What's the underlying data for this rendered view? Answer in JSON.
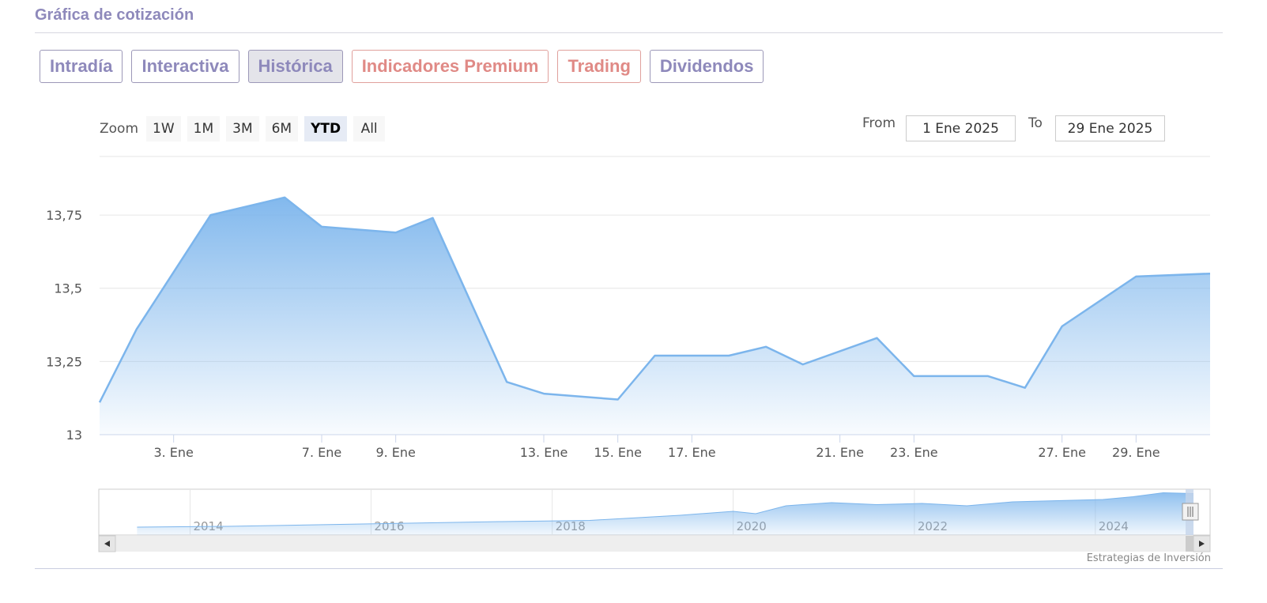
{
  "section_title": "Gráfica de cotización",
  "tabs": [
    {
      "label": "Intradía",
      "active": false,
      "premium": false
    },
    {
      "label": "Interactiva",
      "active": false,
      "premium": false
    },
    {
      "label": "Histórica",
      "active": true,
      "premium": false
    },
    {
      "label": "Indicadores Premium",
      "active": false,
      "premium": true
    },
    {
      "label": "Trading",
      "active": false,
      "premium": true
    },
    {
      "label": "Dividendos",
      "active": false,
      "premium": false
    }
  ],
  "zoom": {
    "label": "Zoom",
    "buttons": [
      {
        "label": "1W",
        "active": false
      },
      {
        "label": "1M",
        "active": false
      },
      {
        "label": "3M",
        "active": false
      },
      {
        "label": "6M",
        "active": false
      },
      {
        "label": "YTD",
        "active": true
      },
      {
        "label": "All",
        "active": false
      }
    ]
  },
  "range": {
    "from_label": "From",
    "from_value": "1 Ene 2025",
    "to_label": "To",
    "to_value": "29 Ene 2025"
  },
  "credits": "Estrategias de Inversión",
  "colors": {
    "line": "#7cb5ec",
    "tab_text": "#8e89bb",
    "premium_text": "#e08a86"
  },
  "chart_data": {
    "type": "area",
    "title": "",
    "xlabel": "",
    "ylabel": "",
    "x_type": "datetime",
    "xlim": [
      "2025-01-01",
      "2025-01-31"
    ],
    "ylim": [
      13,
      13.95
    ],
    "grid": true,
    "y_ticks": [
      {
        "value": 13,
        "label": "13"
      },
      {
        "value": 13.25,
        "label": "13,25"
      },
      {
        "value": 13.5,
        "label": "13,5"
      },
      {
        "value": 13.75,
        "label": "13,75"
      }
    ],
    "x_ticks": [
      {
        "date": "2025-01-03",
        "label": "3. Ene"
      },
      {
        "date": "2025-01-07",
        "label": "7. Ene"
      },
      {
        "date": "2025-01-09",
        "label": "9. Ene"
      },
      {
        "date": "2025-01-13",
        "label": "13. Ene"
      },
      {
        "date": "2025-01-15",
        "label": "15. Ene"
      },
      {
        "date": "2025-01-17",
        "label": "17. Ene"
      },
      {
        "date": "2025-01-21",
        "label": "21. Ene"
      },
      {
        "date": "2025-01-23",
        "label": "23. Ene"
      },
      {
        "date": "2025-01-27",
        "label": "27. Ene"
      },
      {
        "date": "2025-01-29",
        "label": "29. Ene"
      }
    ],
    "series": [
      {
        "points": [
          {
            "date": "2025-01-01",
            "value": 13.11
          },
          {
            "date": "2025-01-02",
            "value": 13.36
          },
          {
            "date": "2025-01-04",
            "value": 13.75
          },
          {
            "date": "2025-01-06",
            "value": 13.81
          },
          {
            "date": "2025-01-07",
            "value": 13.71
          },
          {
            "date": "2025-01-09",
            "value": 13.69
          },
          {
            "date": "2025-01-10",
            "value": 13.74
          },
          {
            "date": "2025-01-12",
            "value": 13.18
          },
          {
            "date": "2025-01-13",
            "value": 13.14
          },
          {
            "date": "2025-01-15",
            "value": 13.12
          },
          {
            "date": "2025-01-16",
            "value": 13.27
          },
          {
            "date": "2025-01-18",
            "value": 13.27
          },
          {
            "date": "2025-01-19",
            "value": 13.3
          },
          {
            "date": "2025-01-20",
            "value": 13.24
          },
          {
            "date": "2025-01-22",
            "value": 13.33
          },
          {
            "date": "2025-01-23",
            "value": 13.2
          },
          {
            "date": "2025-01-25",
            "value": 13.2
          },
          {
            "date": "2025-01-26",
            "value": 13.16
          },
          {
            "date": "2025-01-27",
            "value": 13.37
          },
          {
            "date": "2025-01-29",
            "value": 13.54
          },
          {
            "date": "2025-01-31",
            "value": 13.55
          }
        ]
      }
    ],
    "navigator": {
      "x_range": [
        "2013-01-01",
        "2025-01-31"
      ],
      "labels": [
        "2014",
        "2016",
        "2018",
        "2020",
        "2022",
        "2024"
      ],
      "series": [
        {
          "date": "2013-06-01",
          "v": 0.08
        },
        {
          "date": "2014-06-01",
          "v": 0.1
        },
        {
          "date": "2015-06-01",
          "v": 0.14
        },
        {
          "date": "2016-06-01",
          "v": 0.18
        },
        {
          "date": "2017-06-01",
          "v": 0.22
        },
        {
          "date": "2018-06-01",
          "v": 0.25
        },
        {
          "date": "2019-06-01",
          "v": 0.38
        },
        {
          "date": "2020-01-01",
          "v": 0.48
        },
        {
          "date": "2020-04-01",
          "v": 0.42
        },
        {
          "date": "2020-08-01",
          "v": 0.62
        },
        {
          "date": "2021-02-01",
          "v": 0.7
        },
        {
          "date": "2021-08-01",
          "v": 0.65
        },
        {
          "date": "2022-02-01",
          "v": 0.68
        },
        {
          "date": "2022-08-01",
          "v": 0.62
        },
        {
          "date": "2023-02-01",
          "v": 0.72
        },
        {
          "date": "2023-08-01",
          "v": 0.75
        },
        {
          "date": "2024-02-01",
          "v": 0.78
        },
        {
          "date": "2024-06-01",
          "v": 0.85
        },
        {
          "date": "2024-10-01",
          "v": 0.95
        },
        {
          "date": "2025-01-31",
          "v": 0.93
        }
      ]
    }
  }
}
